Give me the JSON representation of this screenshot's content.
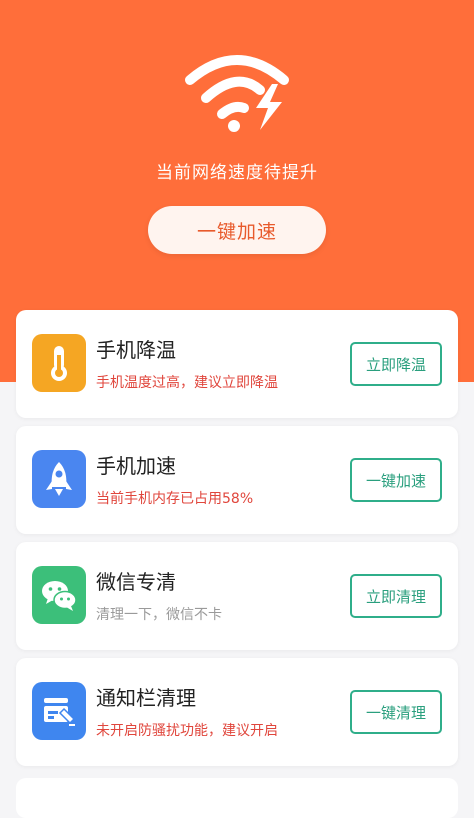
{
  "hero": {
    "status_text": "当前网络速度待提升",
    "boost_button": "一键加速",
    "background_color": "#ff6e3a",
    "icon": "wifi-lightning-icon"
  },
  "cards": [
    {
      "title": "手机降温",
      "desc": "手机温度过高，建议立即降温",
      "button": "立即降温",
      "icon": "thermometer-icon",
      "icon_color": "#f5a623",
      "desc_color": "#e0463c"
    },
    {
      "title": "手机加速",
      "desc": "当前手机内存已占用58%",
      "button": "一键加速",
      "icon": "rocket-icon",
      "icon_color": "#4a86f0",
      "desc_color": "#e0463c"
    },
    {
      "title": "微信专清",
      "desc": "清理一下，微信不卡",
      "button": "立即清理",
      "icon": "wechat-icon",
      "icon_color": "#3cbf7a",
      "desc_color": "#9a9a9a"
    },
    {
      "title": "通知栏清理",
      "desc": "未开启防骚扰功能，建议开启",
      "button": "一键清理",
      "icon": "notification-clean-icon",
      "icon_color": "#3f86ef",
      "desc_color": "#e0463c"
    }
  ],
  "accent_color": "#2fae8a"
}
